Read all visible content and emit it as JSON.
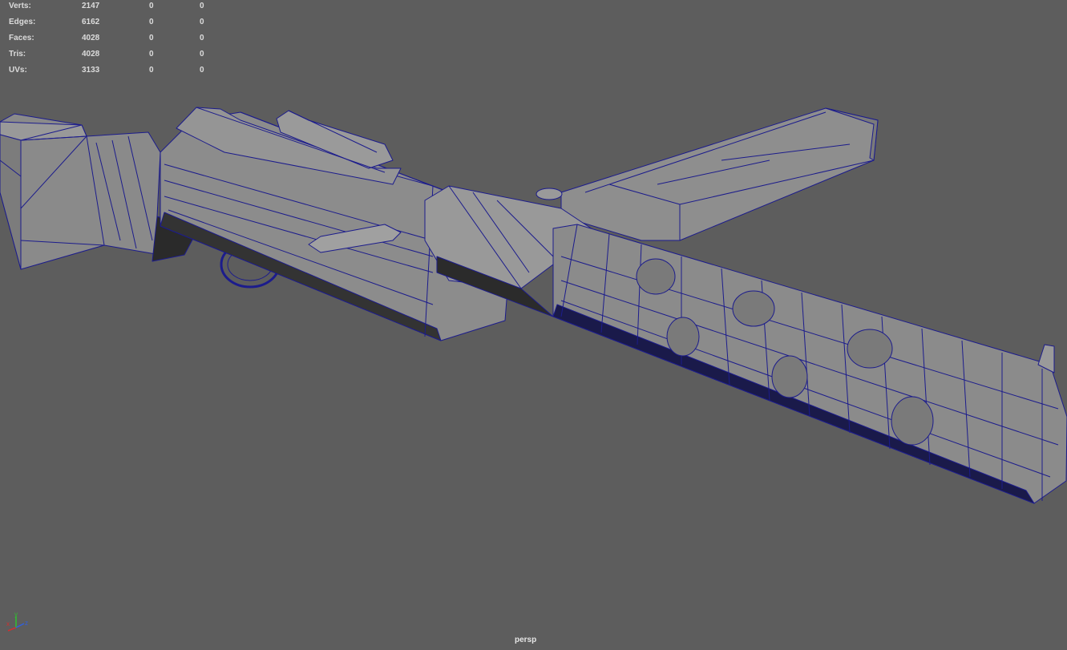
{
  "stats": [
    {
      "label": "Verts:",
      "values": [
        "2147",
        "0",
        "0"
      ]
    },
    {
      "label": "Edges:",
      "values": [
        "6162",
        "0",
        "0"
      ]
    },
    {
      "label": "Faces:",
      "values": [
        "4028",
        "0",
        "0"
      ]
    },
    {
      "label": "Tris:",
      "values": [
        "4028",
        "0",
        "0"
      ]
    },
    {
      "label": "UVs:",
      "values": [
        "3133",
        "0",
        "0"
      ]
    }
  ],
  "camera": "persp",
  "axis_labels": {
    "x": "x",
    "y": "y",
    "z": "z"
  },
  "colors": {
    "background": "#5d5d5d",
    "wireframe": "#1c1c8c",
    "surface": "#8e8e8e"
  }
}
